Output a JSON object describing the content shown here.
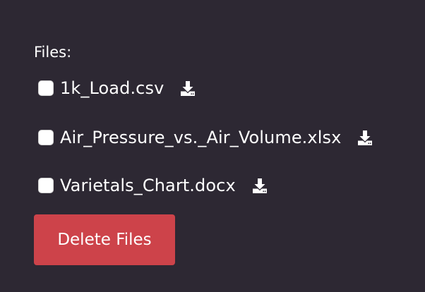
{
  "files_section": {
    "label": "Files:",
    "items": [
      {
        "name": "1k_Load.csv",
        "checked": false,
        "download_icon": "download-icon"
      },
      {
        "name": "Air_Pressure_vs._Air_Volume.xlsx",
        "checked": false,
        "download_icon": "download-icon"
      },
      {
        "name": "Varietals_Chart.docx",
        "checked": false,
        "download_icon": "download-icon"
      }
    ]
  },
  "actions": {
    "delete_label": "Delete Files"
  },
  "colors": {
    "background": "#2d2833",
    "text": "#ffffff",
    "delete_button": "#cd434a"
  }
}
